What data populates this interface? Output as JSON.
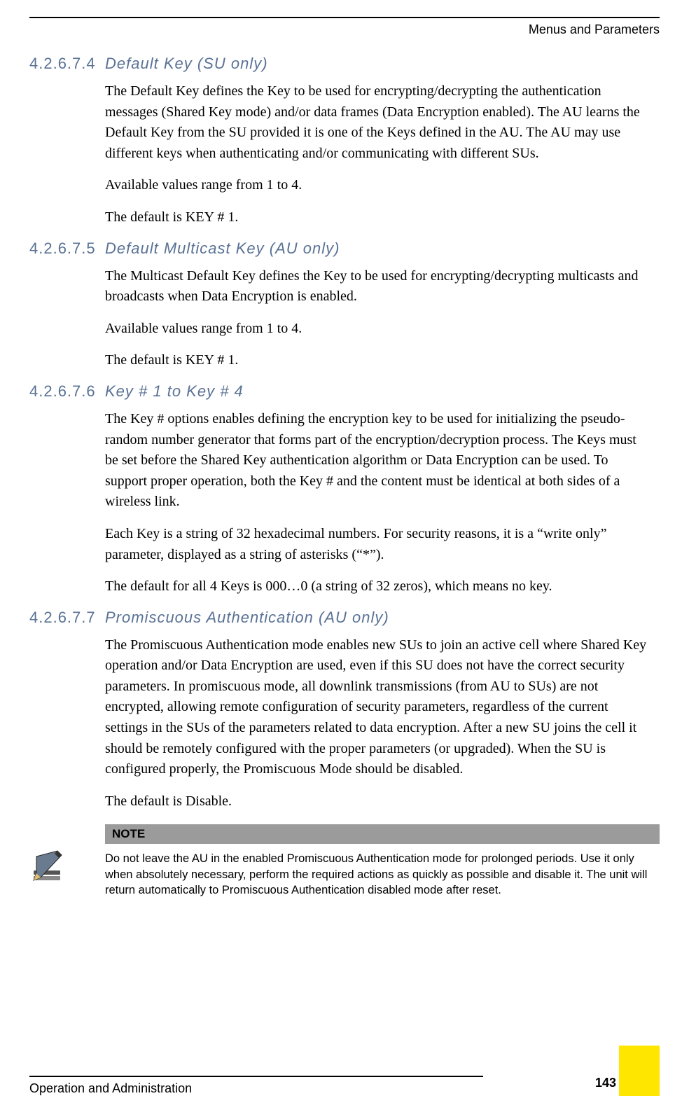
{
  "header": {
    "right_text": "Menus and Parameters"
  },
  "sections": [
    {
      "num": "4.2.6.7.4",
      "title": "Default Key (SU only)",
      "paras": [
        "The Default Key defines the Key to be used for encrypting/decrypting the authentication messages (Shared Key mode) and/or data frames (Data Encryption enabled). The AU learns the Default Key from the SU provided it is one of the Keys defined in the AU. The AU may use different keys when authenticating and/or communicating with different SUs.",
        "Available values range from 1 to 4.",
        "The default is KEY # 1."
      ]
    },
    {
      "num": "4.2.6.7.5",
      "title": "Default Multicast Key (AU only)",
      "paras": [
        "The Multicast Default Key defines the Key to be used for encrypting/decrypting multicasts and broadcasts when Data Encryption is enabled.",
        "Available values range from 1 to 4.",
        "The default is KEY # 1."
      ]
    },
    {
      "num": "4.2.6.7.6",
      "title": "Key # 1 to Key # 4",
      "paras": [
        "The Key # options enables defining the encryption key to be used for initializing the pseudo-random number generator that forms part of the encryption/decryption process. The Keys must be set before the Shared Key authentication algorithm or Data Encryption can be used. To support proper operation, both the Key # and the content must be identical at both sides of a wireless link.",
        "Each Key is a string of 32 hexadecimal numbers. For security reasons, it is a “write only” parameter, displayed as a string of asterisks (“*”).",
        "The default for all 4 Keys is 000…0 (a string of 32 zeros), which means no key."
      ]
    },
    {
      "num": "4.2.6.7.7",
      "title": "Promiscuous Authentication (AU only)",
      "paras": [
        "The Promiscuous Authentication mode enables new SUs to join an active cell where Shared Key operation and/or Data Encryption are used, even if this SU does not have the correct security parameters. In promiscuous mode, all downlink transmissions (from AU to SUs) are not encrypted, allowing remote configuration of security parameters, regardless of the current settings in the SUs of the parameters related to data encryption. After a new SU joins the cell it should be remotely configured with the proper parameters (or upgraded). When the SU is configured properly, the Promiscuous Mode should be disabled.",
        "The default is Disable."
      ]
    }
  ],
  "note": {
    "label": "NOTE",
    "text": "Do not leave the AU in the enabled Promiscuous Authentication mode for prolonged periods. Use it only when absolutely necessary, perform the required actions as quickly as possible and disable it. The unit will return automatically to Promiscuous Authentication disabled mode after reset."
  },
  "footer": {
    "left_text": "Operation and Administration",
    "page_number": "143"
  }
}
